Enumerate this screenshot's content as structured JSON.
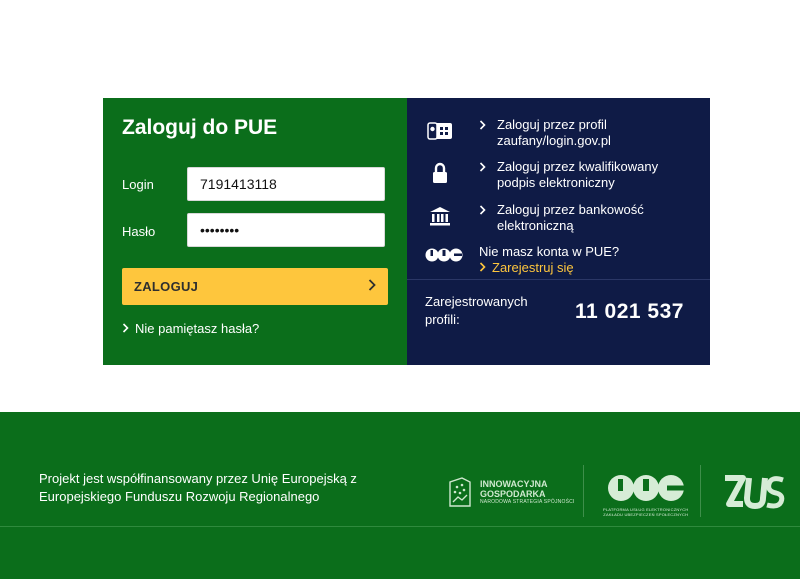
{
  "login": {
    "title": "Zaloguj do PUE",
    "login_label": "Login",
    "login_value": "7191413118",
    "password_label": "Hasło",
    "password_value": "passwd12",
    "button_label": "ZALOGUJ",
    "forgot_link": "Nie pamiętasz hasła?"
  },
  "options": {
    "trusted_profile": "Zaloguj przez profil zaufany/login.gov.pl",
    "qualified_signature": "Zaloguj przez kwalifikowany podpis elektroniczny",
    "bank": "Zaloguj przez bankowość elektroniczną",
    "no_account": "Nie masz konta w PUE?",
    "register": "Zarejestruj się"
  },
  "registered": {
    "label": "Zarejestrowanych profili:",
    "count": "11 021 537"
  },
  "footer": {
    "text": "Projekt jest współfinansowany przez Unię Europejską z Europejskiego Funduszu Rozwoju Regionalnego",
    "ig_line1": "INNOWACYJNA",
    "ig_line2": "GOSPODARKA",
    "ig_sub": "NARODOWA STRATEGIA SPÓJNOŚCI",
    "pue_logo": "PUE",
    "pue_sub1": "PLATFORMA USŁUG ELEKTRONICZNYCH",
    "pue_sub2": "ZAKŁADU UBEZPIECZEŃ SPOŁECZNYCH",
    "zus_logo": "ZUS"
  },
  "colors": {
    "green": "#0b6e1b",
    "navy": "#0f1b46",
    "yellow": "#fec63d"
  },
  "icons": [
    "id-card-icon",
    "lock-icon",
    "bank-icon",
    "pue-logo-icon",
    "chevron-right-icon"
  ]
}
